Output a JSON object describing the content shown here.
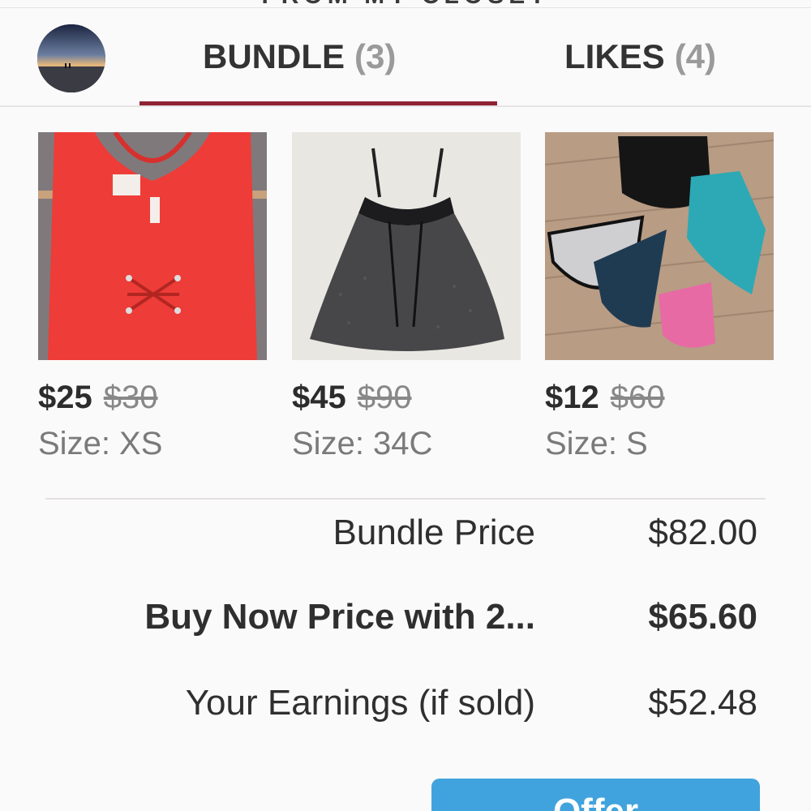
{
  "header": {
    "closet_title": "FROM MY CLOSET"
  },
  "tabs": [
    {
      "label": "BUNDLE",
      "count": "(3)",
      "active": true
    },
    {
      "label": "LIKES",
      "count": "(4)",
      "active": false
    }
  ],
  "colors": {
    "accent_underline": "#8f2334",
    "offer_button": "#41a3dd"
  },
  "products": [
    {
      "price": "$25",
      "original_price": "$30",
      "size": "Size: XS",
      "image": "red-tank-top"
    },
    {
      "price": "$45",
      "original_price": "$90",
      "size": "Size: 34C",
      "image": "black-babydoll"
    },
    {
      "price": "$12",
      "original_price": "$60",
      "size": "Size: S",
      "image": "underwear-set"
    }
  ],
  "summary": {
    "bundle_price_label": "Bundle Price",
    "bundle_price_value": "$82.00",
    "buy_now_label": "Buy Now Price with 2...",
    "buy_now_value": "$65.60",
    "earnings_label": "Your Earnings (if sold)",
    "earnings_value": "$52.48"
  },
  "actions": {
    "offer_label": "Offer"
  }
}
